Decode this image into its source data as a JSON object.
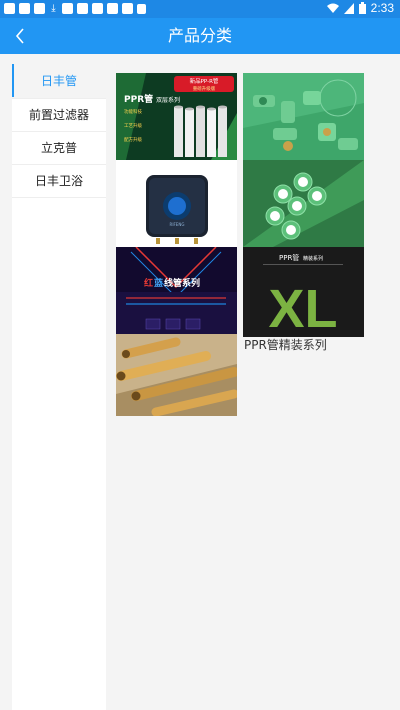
{
  "status_bar": {
    "time": "2:33"
  },
  "header": {
    "title": "产品分类"
  },
  "sidebar": {
    "items": [
      {
        "label": "日丰管",
        "active": true
      },
      {
        "label": "前置过滤器",
        "active": false
      },
      {
        "label": "立克普",
        "active": false
      },
      {
        "label": "日丰卫浴",
        "active": false
      }
    ]
  },
  "products": [
    {
      "name": "PPR管双层系列 poster",
      "image_text": {
        "headline": "PPR管",
        "headline_sub": "双层系列",
        "badge": "新品PP-R管",
        "badge_sub": "重磅升级版",
        "feature_1": "功能科技",
        "feature_2": "工艺升级",
        "feature_3": "配方升级"
      }
    },
    {
      "name": "green pipe fittings photo"
    },
    {
      "name": "water purifier unit photo"
    },
    {
      "name": "green pipes bundle photo"
    },
    {
      "name": "红蓝线管系列 poster",
      "image_text": {
        "headline_red": "红",
        "headline_blue": "蓝",
        "headline_rest": "线管系列"
      }
    },
    {
      "name": "PPR管精装系列 poster",
      "caption": "PPR管精装系列",
      "image_text": {
        "top": "PPR管",
        "top_sub": "精装系列",
        "logo": "XL"
      }
    },
    {
      "name": "brass pipes photo"
    }
  ],
  "colors": {
    "primary": "#2196f3",
    "status_bar": "#1e88e5",
    "active_text": "#2196f3"
  }
}
